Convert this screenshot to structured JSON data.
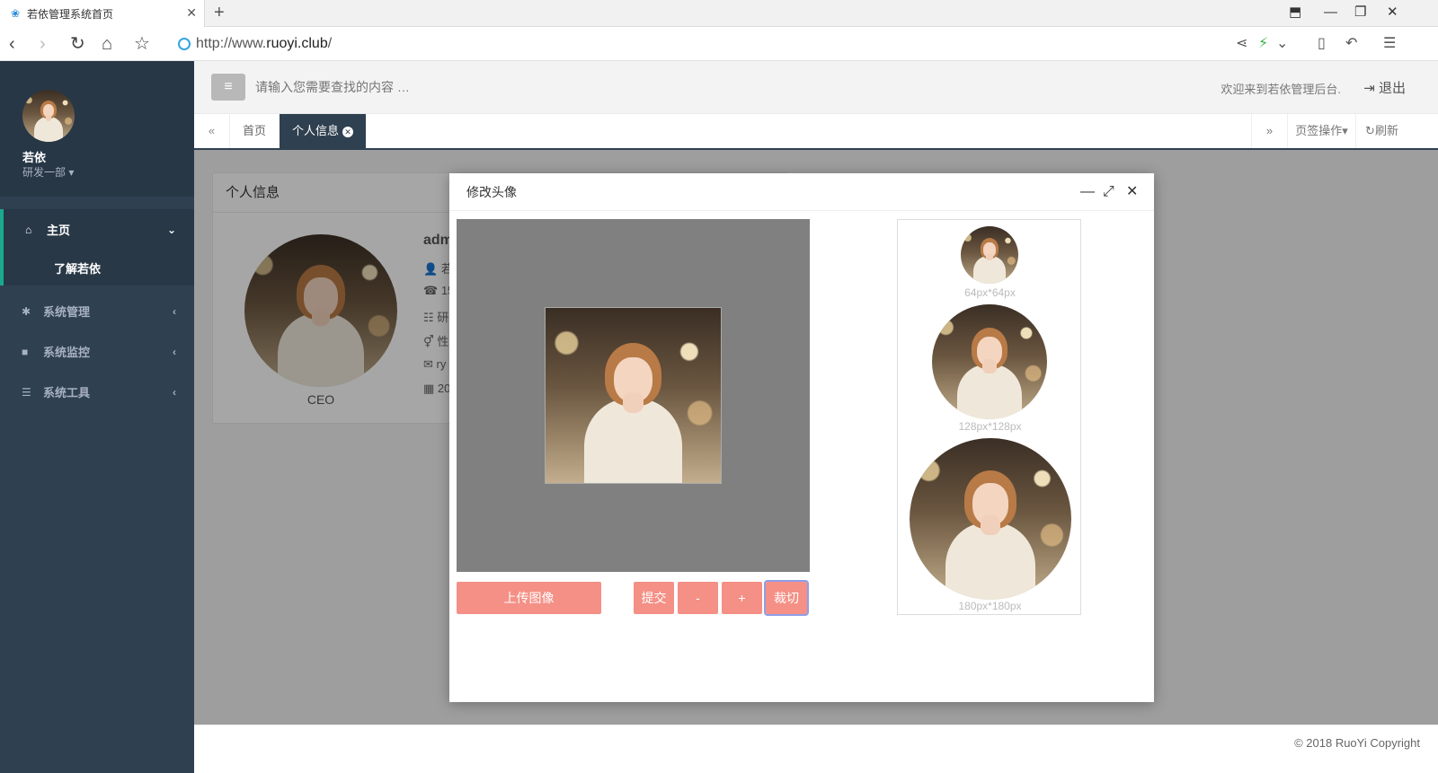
{
  "browser": {
    "tab_title": "若依管理系统首页",
    "url_prefix": "http://www.",
    "url_domain": "ruoyi.club",
    "url_suffix": "/"
  },
  "sidebar": {
    "user_name": "若依",
    "user_dept": "研发一部",
    "items": [
      {
        "label": "主页",
        "icon": "home-icon"
      },
      {
        "label": "系统管理",
        "icon": "gear-icon"
      },
      {
        "label": "系统监控",
        "icon": "video-icon"
      },
      {
        "label": "系统工具",
        "icon": "bars-icon"
      }
    ],
    "subitem": "了解若依"
  },
  "header": {
    "search_placeholder": "请输入您需要查找的内容 …",
    "welcome": "欢迎来到若依管理后台.",
    "logout": "退出"
  },
  "tabs": {
    "home": "首页",
    "active": "个人信息",
    "tab_ops": "页签操作",
    "refresh": "刷新"
  },
  "profile_card": {
    "title": "个人信息",
    "role": "CEO",
    "name_partial": "adm",
    "lines": [
      "若",
      "15",
      "研",
      "性",
      "ry",
      "20"
    ]
  },
  "modal": {
    "title": "修改头像",
    "upload_btn": "上传图像",
    "submit_btn": "提交",
    "zoom_out_btn": "-",
    "zoom_in_btn": "+",
    "crop_btn": "裁切",
    "preview_labels": [
      "64px*64px",
      "128px*128px",
      "180px*180px"
    ]
  },
  "footer": {
    "copyright": "© 2018 RuoYi Copyright"
  },
  "colors": {
    "sidebar_bg": "#2f4050",
    "accent": "#19aa8d",
    "button": "#f49086"
  }
}
